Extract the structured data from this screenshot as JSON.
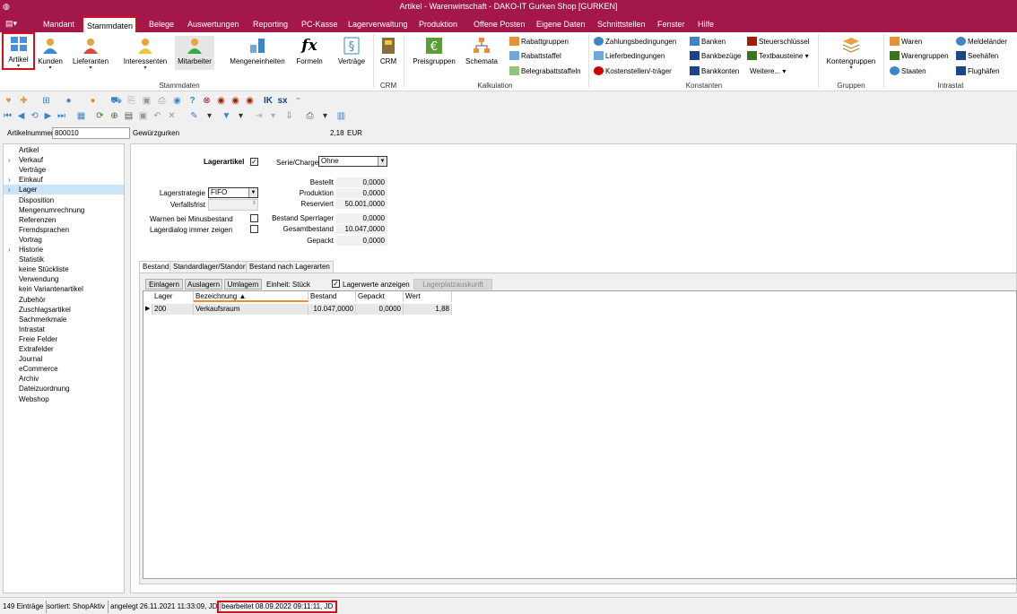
{
  "window": {
    "title": "Artikel - Warenwirtschaft - DAKO-IT Gurken Shop [GURKEN]"
  },
  "menu": {
    "items": [
      "Mandant",
      "Stammdaten",
      "Belege",
      "Auswertungen",
      "Reporting",
      "PC-Kasse",
      "Lagerverwaltung",
      "Produktion",
      "Offene Posten",
      "Eigene Daten",
      "Schnittstellen",
      "Fenster",
      "Hilfe"
    ],
    "active": "Stammdaten"
  },
  "ribbon": {
    "stammdaten": {
      "artikel": "Artikel",
      "kunden": "Kunden",
      "lieferanten": "Lieferanten",
      "interessenten": "Interessenten",
      "mitarbeiter": "Mitarbeiter",
      "mengeneinheiten": "Mengeneinheiten",
      "formeln": "Formeln",
      "vertraege": "Verträge",
      "group": "Stammdaten"
    },
    "crm": {
      "crm": "CRM",
      "group": "CRM"
    },
    "kalkulation": {
      "preisgruppen": "Preisgruppen",
      "schemata": "Schemata",
      "rabattgruppen": "Rabattgruppen",
      "rabattstaffel": "Rabattstaffel",
      "belegrabattstaffeln": "Belegrabattstaffeln",
      "group": "Kalkulation"
    },
    "konstanten": {
      "zahlungsbedingungen": "Zahlungsbedingungen",
      "lieferbedingungen": "Lieferbedingungen",
      "kostenstellen": "Kostenstellen/-träger",
      "banken": "Banken",
      "bankbezuege": "Bankbezüge",
      "bankkonten": "Bankkonten",
      "steuerschluessel": "Steuerschlüssel",
      "textbausteine": "Textbausteine",
      "weitere": "Weitere...",
      "group": "Konstanten"
    },
    "gruppen": {
      "kontengruppen": "Kontengruppen",
      "group": "Gruppen"
    },
    "intrastat": {
      "waren": "Waren",
      "warengruppen": "Warengruppen",
      "staaten": "Staaten",
      "meldelaender": "Meldeländer",
      "seehaefen": "Seehäfen",
      "flughaefen": "Flughäfen",
      "group": "Intrastat"
    }
  },
  "toolbar2": {
    "ik": "IK",
    "sx": "sx"
  },
  "article": {
    "label": "Artikelnummer",
    "number": "800010",
    "name": "Gewürzgurken",
    "price": "2,18",
    "currency": "EUR"
  },
  "tree": {
    "items": [
      "Artikel",
      "Verkauf",
      "Verträge",
      "Einkauf",
      "Lager",
      "Disposition",
      "Mengenumrechnung",
      "Referenzen",
      "Fremdsprachen",
      "Vortrag",
      "Historie",
      "Statistik",
      "keine Stückliste",
      "Verwendung",
      "kein Variantenartikel",
      "Zubehör",
      "Zuschlagsartikel",
      "Sachmerkmale",
      "Intrastat",
      "Freie Felder",
      "Extrafelder",
      "Journal",
      "eCommerce",
      "Archiv",
      "Dateizuordnung",
      "Webshop"
    ],
    "selected": "Lager"
  },
  "lager": {
    "lagerartikel_label": "Lagerartikel",
    "serie_label": "Serie/Charge",
    "serie_value": "Ohne",
    "lagerstrategie_label": "Lagerstrategie",
    "lagerstrategie_value": "FIFO",
    "verfallsfrist_label": "Verfallsfrist",
    "warnen_label": "Warnen bei Minusbestand",
    "dialog_label": "Lagerdialog immer zeigen",
    "bestellt_label": "Bestellt",
    "bestellt": "0,0000",
    "produktion_label": "Produktion",
    "produktion": "0,0000",
    "reserviert_label": "Reserviert",
    "reserviert": "50.001,0000",
    "sperrlager_label": "Bestand Sperrlager",
    "sperrlager": "0,0000",
    "gesamt_label": "Gesamtbestand",
    "gesamt": "10.047,0000",
    "gepackt_label": "Gepackt",
    "gepackt": "0,0000"
  },
  "tabs": [
    "Bestand",
    "Standardlager/Standort",
    "Bestand nach Lagerarten"
  ],
  "bestand": {
    "einlagern": "Einlagern",
    "auslagern": "Auslagern",
    "umlagern": "Umlagern",
    "einheit": "Einheit:  Stück",
    "lagerwerte": "Lagerwerte anzeigen",
    "lagerplatz": "Lagerplatzauskunft",
    "columns": [
      "Lager",
      "Bezeichnung",
      "Bestand",
      "Gepackt",
      "Wert"
    ],
    "rows": [
      [
        "200",
        "Verkaufsraum",
        "10.047,0000",
        "0,0000",
        "1,88"
      ]
    ]
  },
  "status": {
    "count": "149 Einträge",
    "sort": "sortiert: ShopAktiv",
    "created": "angelegt 26.11.2021 11:33:09, JD",
    "edited": "bearbeitet 08.09.2022 09:11:11, JD"
  },
  "colors": {
    "accent": "#a3174a",
    "highlight": "#d0101c",
    "selected": "#cce4f7"
  }
}
